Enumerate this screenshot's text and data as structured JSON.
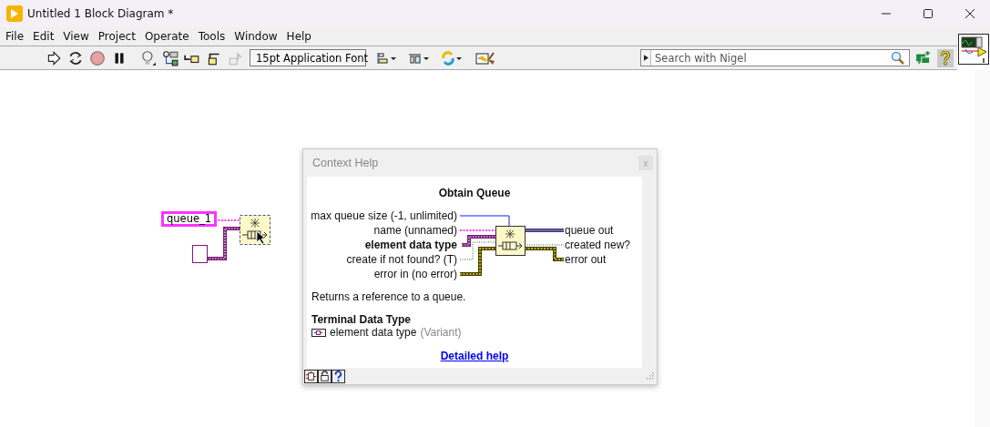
{
  "window": {
    "title": "Untitled 1 Block Diagram *"
  },
  "menu": [
    "File",
    "Edit",
    "View",
    "Project",
    "Operate",
    "Tools",
    "Window",
    "Help"
  ],
  "toolbar": {
    "font": "15pt Application Font",
    "search": {
      "placeholder": "Search with Nigel"
    }
  },
  "diagram": {
    "constant": "queue_1"
  },
  "context_help": {
    "title": "Context Help",
    "close": "x",
    "function": "Obtain Queue",
    "inputs": [
      {
        "label": "max queue size (-1, unlimited)",
        "required": false
      },
      {
        "label": "name (unnamed)",
        "required": false
      },
      {
        "label": "element data type",
        "required": true
      },
      {
        "label": "create if not found? (T)",
        "required": false
      },
      {
        "label": "error in (no error)",
        "required": false
      }
    ],
    "outputs": [
      "queue out",
      "created new?",
      "error out"
    ],
    "description": "Returns a reference to a queue.",
    "section": "Terminal Data Type",
    "terminal": {
      "name": "element data type",
      "type": "(Variant)"
    },
    "link": "Detailed help"
  }
}
